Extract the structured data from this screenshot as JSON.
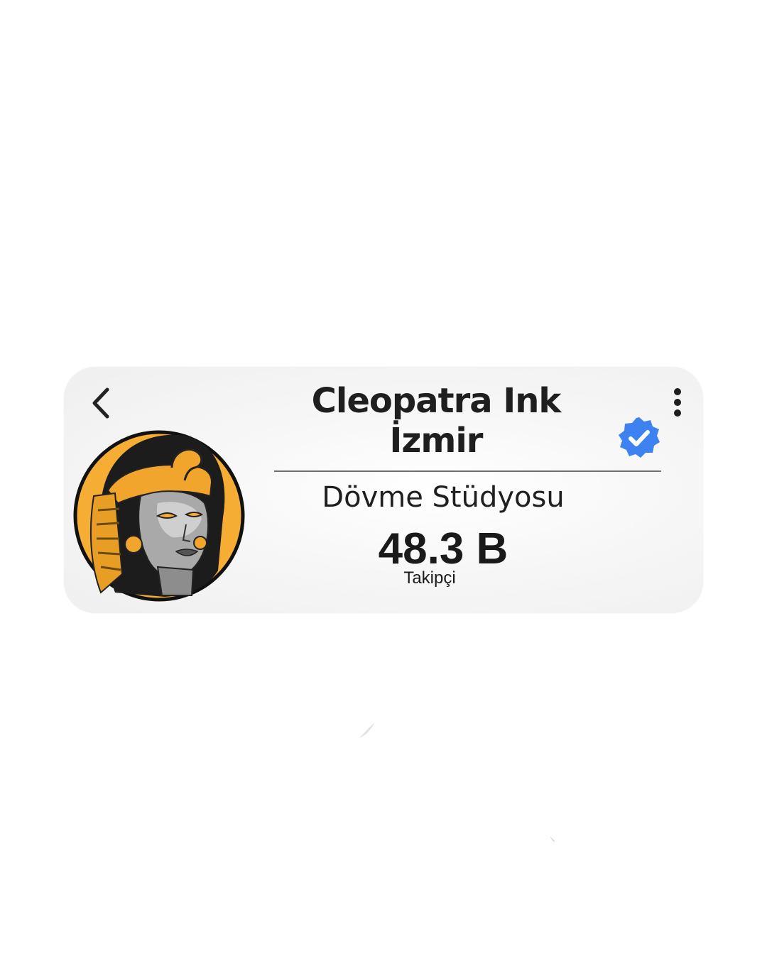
{
  "profile": {
    "name_line1": "Cleopatra Ink",
    "name_line2": "İzmir",
    "category": "Dövme Stüdyosu",
    "followers_count": "48.3 B",
    "followers_label": "Takipçi",
    "verified": true
  },
  "icons": {
    "back": "chevron-left-icon",
    "more": "more-vertical-icon",
    "verified": "verified-badge-icon",
    "avatar": "cleopatra-logo"
  },
  "colors": {
    "accent_blue": "#3d82f0",
    "logo_orange": "#f6ad34",
    "text_dark": "#1f1f1f",
    "card_bg": "#f2f2f2"
  }
}
